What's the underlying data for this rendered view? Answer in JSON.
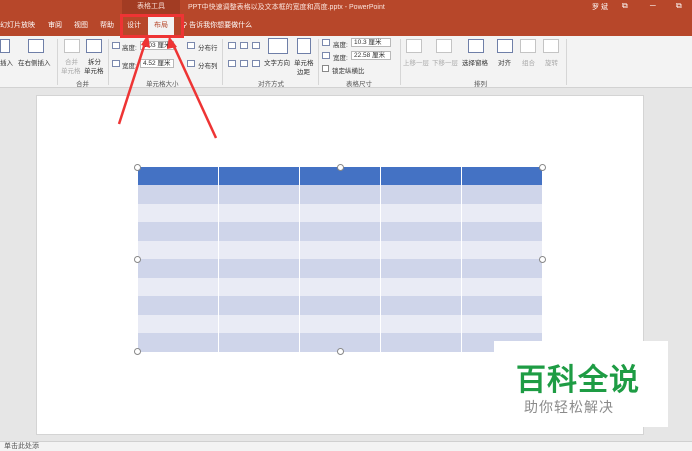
{
  "titlebar": {
    "tools_label": "表格工具",
    "doc_title": "PPT中快速调整表格以及文本框的宽度和高度.pptx - PowerPoint",
    "user": "罗 斌",
    "restore": "⧉",
    "minimize": "─"
  },
  "tabs": [
    {
      "label": "幻灯片放映"
    },
    {
      "label": "审阅"
    },
    {
      "label": "视图"
    },
    {
      "label": "帮助"
    },
    {
      "label": "设计"
    },
    {
      "label": "布局"
    }
  ],
  "tellme": "告诉我你想要做什么",
  "ribbon": {
    "insert_below": "插入",
    "insert_right": "在右侧插入",
    "merge_cells": "合并",
    "merge_cells_2": "单元格",
    "split_cells": "拆分",
    "split_cells_2": "单元格",
    "group_merge": "合并",
    "height_label": "高度:",
    "height_value": "1.03 厘米",
    "width_label": "宽度:",
    "width_value": "4.52 厘米",
    "distribute_rows": "分布行",
    "distribute_cols": "分布列",
    "group_cellsize": "单元格大小",
    "text_direction": "文字方向",
    "cell_margins": "单元格",
    "cell_margins_2": "边距",
    "group_alignment": "对齐方式",
    "table_height_label": "高度:",
    "table_height_value": "10.3 厘米",
    "table_width_label": "宽度:",
    "table_width_value": "22.58 厘米",
    "lock_ratio": "锁定纵横比",
    "group_tablesize": "表格尺寸",
    "bring_forward": "上移一层",
    "send_backward": "下移一层",
    "selection_pane": "选择窗格",
    "align": "对齐",
    "group": "组合",
    "rotate": "旋转",
    "group_arrange": "排列"
  },
  "table": {
    "rows": 10,
    "cols": 5
  },
  "statusbar": {
    "text": "单击此处添"
  },
  "watermark": {
    "title": "百科全说",
    "subtitle": "助你轻松解决"
  },
  "colors": {
    "accent": "#b7472a",
    "table_header": "#4472c4",
    "table_band_odd": "#cfd5ea",
    "table_band_even": "#e9ebf5",
    "annotation": "#ee3434",
    "watermark_green": "#1e9c44"
  }
}
